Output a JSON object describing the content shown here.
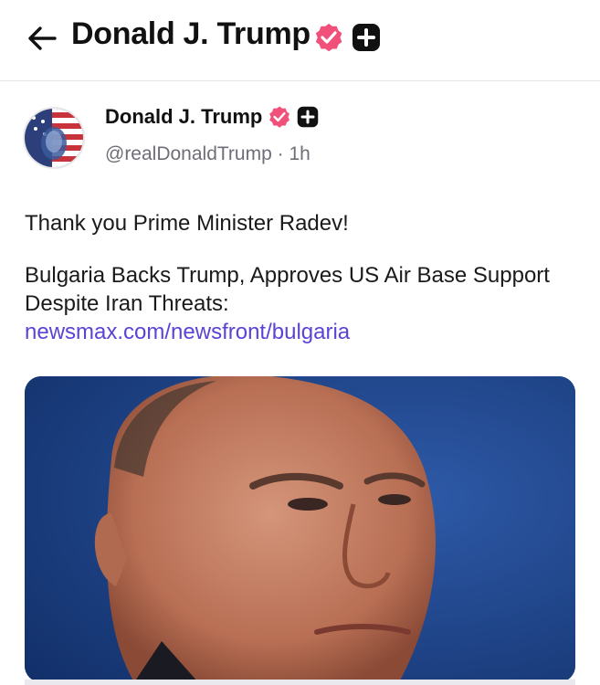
{
  "header": {
    "back_icon": "arrow-left-icon",
    "title": "Donald J. Trump"
  },
  "post": {
    "author_name": "Donald J. Trump",
    "handle": "@realDonaldTrump",
    "separator": "·",
    "time": "1h",
    "text_line1": "Thank you Prime Minister Radev!",
    "text_line2": "Bulgaria Backs Trump, Approves US Air Base Support Despite Iran Threats:",
    "link_text": "newsmax.com/newsfront/bulgaria"
  },
  "colors": {
    "verified_badge": "#f0507a",
    "link": "#5a43d6",
    "handle_gray": "#6e6e78",
    "media_background": "#1f3f7a"
  },
  "icons": [
    "arrow-left-icon",
    "verified-badge-icon",
    "plus-badge-icon"
  ]
}
